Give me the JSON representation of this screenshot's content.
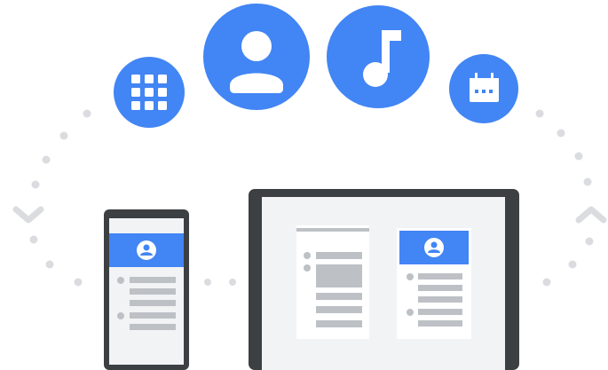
{
  "illustration": {
    "icons": [
      {
        "name": "apps-grid-icon"
      },
      {
        "name": "account-icon"
      },
      {
        "name": "music-note-icon"
      },
      {
        "name": "calendar-icon"
      }
    ],
    "sync_arrows": [
      "chevron-down-icon",
      "chevron-up-icon"
    ],
    "devices": [
      "phone",
      "tablet"
    ]
  },
  "colors": {
    "accent": "#4285f4",
    "device_frame": "#3c4043",
    "screen_bg": "#f1f3f4",
    "dot": "#dadce0",
    "line": "#bdc1c6",
    "card": "#ffffff"
  }
}
